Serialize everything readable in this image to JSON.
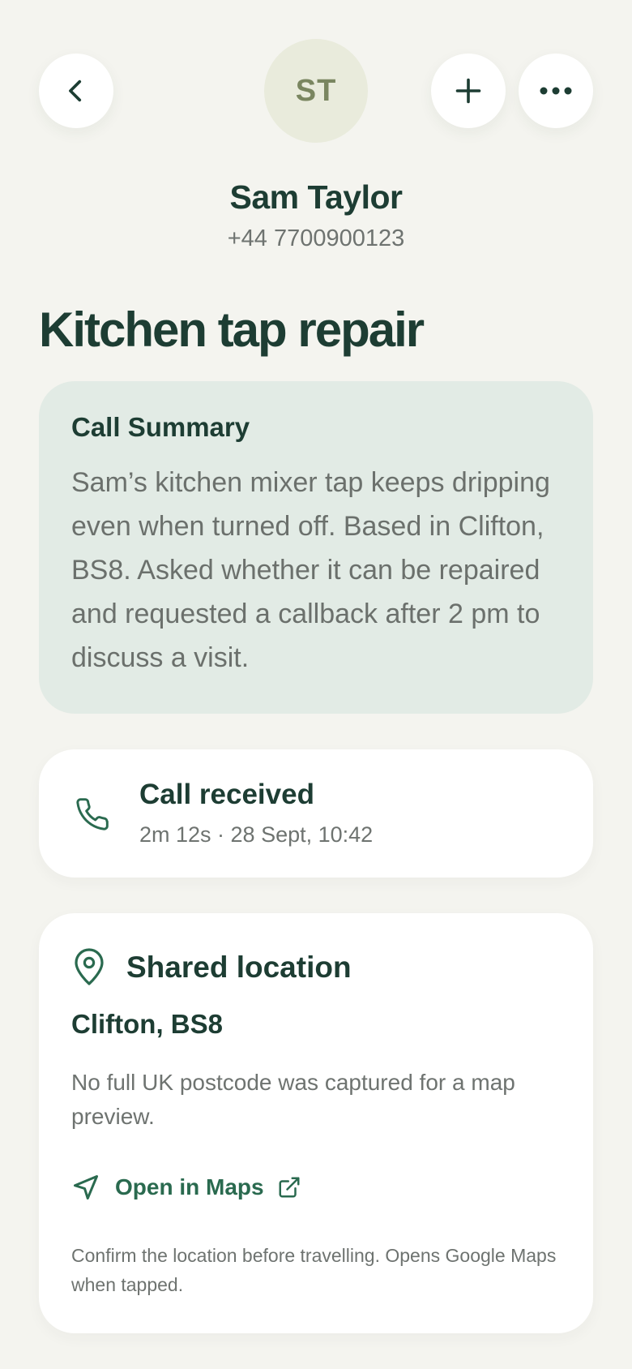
{
  "header": {
    "avatar_initials": "ST",
    "contact_name": "Sam Taylor",
    "contact_phone": "+44 7700900123",
    "buttons": {
      "back_icon": "chevron-left-icon",
      "add_icon": "plus-icon",
      "more_icon": "more-horizontal-icon"
    }
  },
  "job": {
    "title": "Kitchen tap repair"
  },
  "summary": {
    "heading": "Call Summary",
    "text": "Sam’s kitchen mixer tap keeps dripping even when turned off. Based in Clifton, BS8. Asked whether it can be repaired and requested a callback after 2 pm to discuss a visit."
  },
  "call": {
    "icon": "phone-icon",
    "title": "Call received",
    "meta": "2m 12s · 28 Sept, 10:42"
  },
  "location": {
    "icon": "map-pin-icon",
    "heading": "Shared location",
    "area": "Clifton, BS8",
    "note": "No full UK postcode was captured for a map preview.",
    "link_label": "Open in Maps",
    "link_icon": "navigation-arrow-icon",
    "external_icon": "external-link-icon",
    "footnote": "Confirm the location before travelling. Opens Google Maps when tapped."
  },
  "colors": {
    "background": "#f4f4ef",
    "primary_text": "#1d3d33",
    "accent": "#2a6a4f",
    "summary_bg": "#e2ebe5",
    "avatar_bg": "#e9ebdc"
  }
}
